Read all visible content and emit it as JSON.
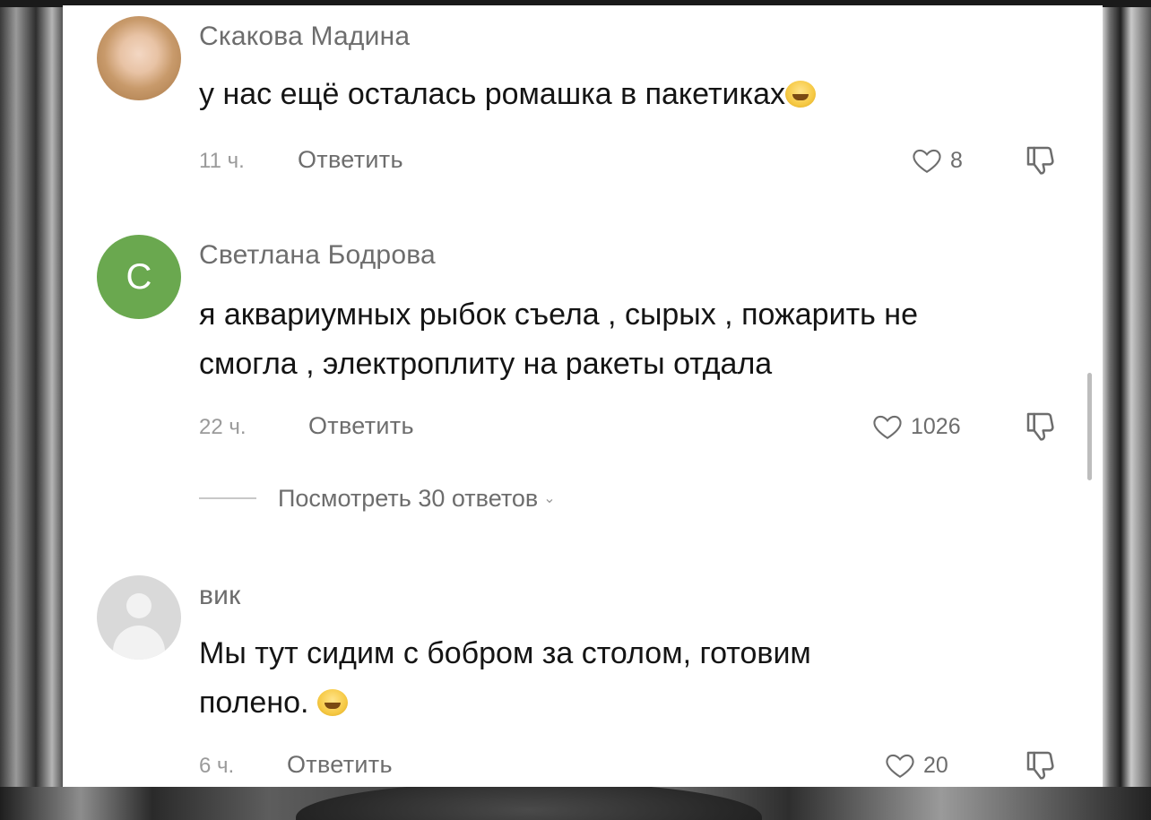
{
  "comments": [
    {
      "author": "Скакова Мадина",
      "text": "у нас ещё осталась ромашка в пакетиках",
      "time": "11 ч.",
      "reply_label": "Ответить",
      "likes": "8",
      "avatar_type": "photo",
      "trailing_emoji": "face-with-tears-of-joy"
    },
    {
      "author": "Светлана Бодрова",
      "avatar_letter": "С",
      "text_line1": "я аквариумных рыбок съела , сырых , пожарить не",
      "text_line2": "смогла , электроплиту на ракеты отдала",
      "time": "22 ч.",
      "reply_label": "Ответить",
      "likes": "1026",
      "view_replies": "Посмотреть 30 ответов"
    },
    {
      "author": "вик",
      "text_line1": "Мы тут сидим с бобром за столом, готовим",
      "text_line2": "полено.",
      "time": "6 ч.",
      "reply_label": "Ответить",
      "likes": "20",
      "avatar_type": "default",
      "trailing_emoji": "smirking-face"
    }
  ],
  "colors": {
    "background": "#ffffff",
    "letter_avatar": "#6aa84f",
    "secondary_text": "#6d6d6d",
    "primary_text": "#141414"
  }
}
